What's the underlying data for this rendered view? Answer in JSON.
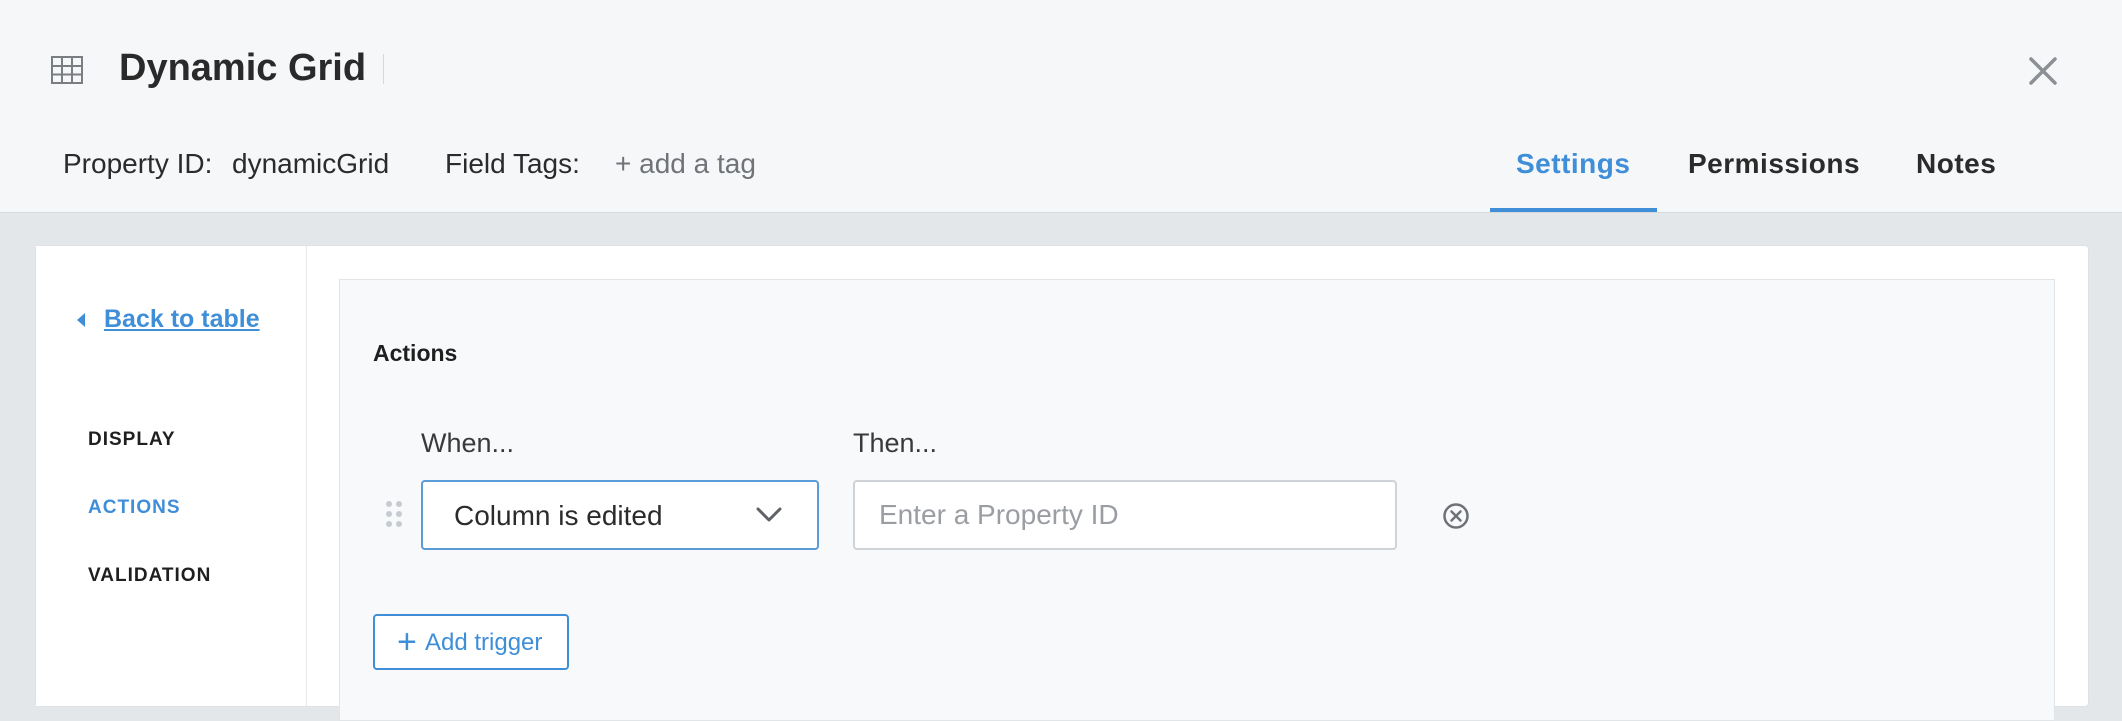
{
  "header": {
    "icon": "table-grid-icon",
    "title": "Dynamic Grid",
    "property_id_label": "Property ID:",
    "property_id_value": "dynamicGrid",
    "field_tags_label": "Field Tags:",
    "add_tag_label": "+ add a tag",
    "close_icon": "close-icon"
  },
  "tabs": [
    {
      "label": "Settings",
      "active": true
    },
    {
      "label": "Permissions",
      "active": false
    },
    {
      "label": "Notes",
      "active": false
    }
  ],
  "sidebar": {
    "back_label": "Back to table",
    "items": [
      {
        "label": "DISPLAY",
        "active": false
      },
      {
        "label": "ACTIONS",
        "active": true
      },
      {
        "label": "VALIDATION",
        "active": false
      }
    ]
  },
  "main": {
    "section_title": "Actions",
    "when_label": "When...",
    "then_label": "Then...",
    "trigger": {
      "when_value": "Column is edited",
      "then_placeholder": "Enter a Property ID",
      "then_value": ""
    },
    "add_trigger_label": "Add trigger"
  },
  "colors": {
    "accent": "#3f8ed8",
    "text": "#2b2b2b",
    "muted": "#707478",
    "background": "#e4e7ea"
  }
}
